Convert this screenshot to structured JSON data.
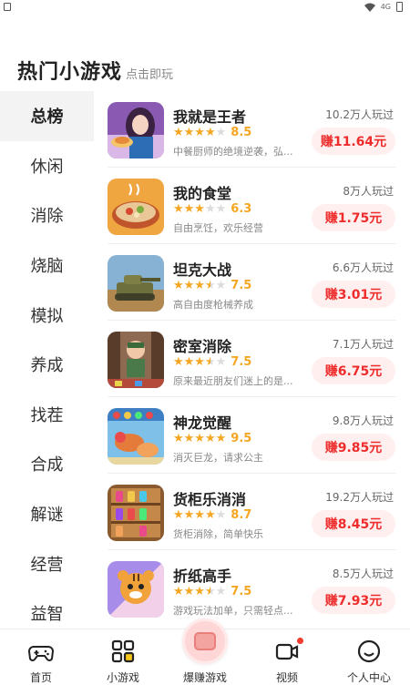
{
  "header": {
    "title": "热门小游戏",
    "subtitle": "点击即玩"
  },
  "status": {
    "signal_text": "4G"
  },
  "categories": [
    "总榜",
    "休闲",
    "消除",
    "烧脑",
    "模拟",
    "养成",
    "找茬",
    "合成",
    "解谜",
    "经营",
    "益智"
  ],
  "active_category": "总榜",
  "games": [
    {
      "name": "我就是王者",
      "rating": "8.5",
      "stars": 4,
      "desc": "中餐厨师的绝境逆袭，弘...",
      "players": "10.2万人玩过",
      "earn": "赚11.64元",
      "thumb_icon": "chef-girl-thumb"
    },
    {
      "name": "我的食堂",
      "rating": "6.3",
      "stars": 3,
      "desc": "自由烹饪，欢乐经营",
      "players": "8万人玩过",
      "earn": "赚1.75元",
      "thumb_icon": "food-bowl-thumb"
    },
    {
      "name": "坦克大战",
      "rating": "7.5",
      "stars": 3.5,
      "desc": "高自由度枪械养成",
      "players": "6.6万人玩过",
      "earn": "赚3.01元",
      "thumb_icon": "tank-thumb"
    },
    {
      "name": "密室消除",
      "rating": "7.5",
      "stars": 3.5,
      "desc": "原来最近朋友们迷上的是...",
      "players": "7.1万人玩过",
      "earn": "赚6.75元",
      "thumb_icon": "escape-room-thumb"
    },
    {
      "name": "神龙觉醒",
      "rating": "9.5",
      "stars": 5,
      "desc": "消灭巨龙，请求公主",
      "players": "9.8万人玩过",
      "earn": "赚9.85元",
      "thumb_icon": "dragon-thumb"
    },
    {
      "name": "货柜乐消消",
      "rating": "8.7",
      "stars": 4,
      "desc": "货柜消除，简单快乐",
      "players": "19.2万人玩过",
      "earn": "赚8.45元",
      "thumb_icon": "shelf-thumb"
    },
    {
      "name": "折纸高手",
      "rating": "7.5",
      "stars": 3.5,
      "desc": "游戏玩法加单，只需轻点...",
      "players": "8.5万人玩过",
      "earn": "赚7.93元",
      "thumb_icon": "tiger-thumb"
    }
  ],
  "tabs": [
    {
      "label": "首页",
      "icon": "gamepad-icon"
    },
    {
      "label": "小游戏",
      "icon": "grid-icon"
    },
    {
      "label": "爆赚游戏",
      "icon": "ticket-icon"
    },
    {
      "label": "视频",
      "icon": "video-icon"
    },
    {
      "label": "个人中心",
      "icon": "smile-icon"
    }
  ],
  "colors": {
    "accent_red": "#ee2c2c",
    "star": "#f5a623",
    "earn_bg": "#fff0ef"
  }
}
